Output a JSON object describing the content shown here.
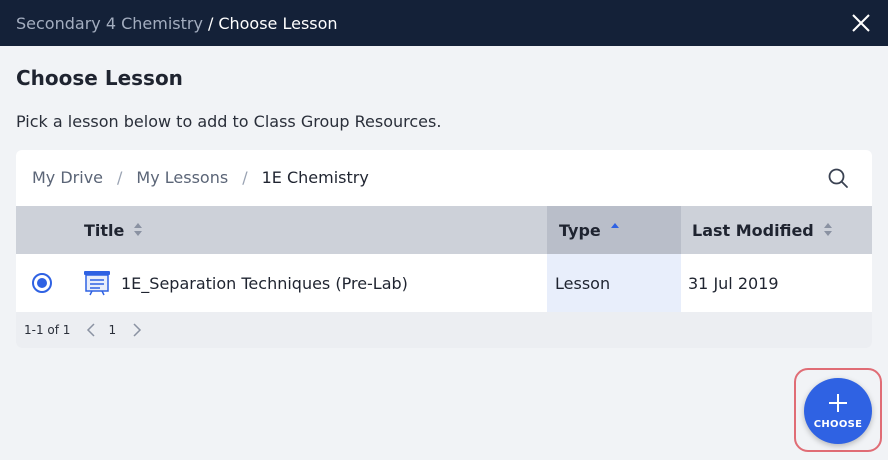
{
  "header": {
    "parent_crumb": "Secondary 4 Chemistry",
    "separator": "/",
    "current_crumb": "Choose Lesson",
    "close_icon": "close-icon"
  },
  "main": {
    "title": "Choose Lesson",
    "subtitle": "Pick a lesson below to add to Class Group Resources."
  },
  "browser": {
    "path": [
      "My Drive",
      "My Lessons",
      "1E Chemistry"
    ],
    "path_separator": "/",
    "search_icon": "search-icon"
  },
  "table": {
    "columns": [
      {
        "label": "Title",
        "sort": "none"
      },
      {
        "label": "Type",
        "sort": "ascending"
      },
      {
        "label": "Last Modified",
        "sort": "none"
      }
    ],
    "rows": [
      {
        "selected": true,
        "icon": "lesson-icon",
        "title": "1E_Separation Techniques (Pre-Lab)",
        "type": "Lesson",
        "last_modified": "31 Jul 2019"
      }
    ]
  },
  "pagination": {
    "range": "1-1 of 1",
    "current_page": "1"
  },
  "choose_button": {
    "label": "CHOOSE",
    "icon": "plus-icon"
  },
  "colors": {
    "header_bg": "#142138",
    "accent": "#2f62e3",
    "highlight": "#e06c75"
  }
}
